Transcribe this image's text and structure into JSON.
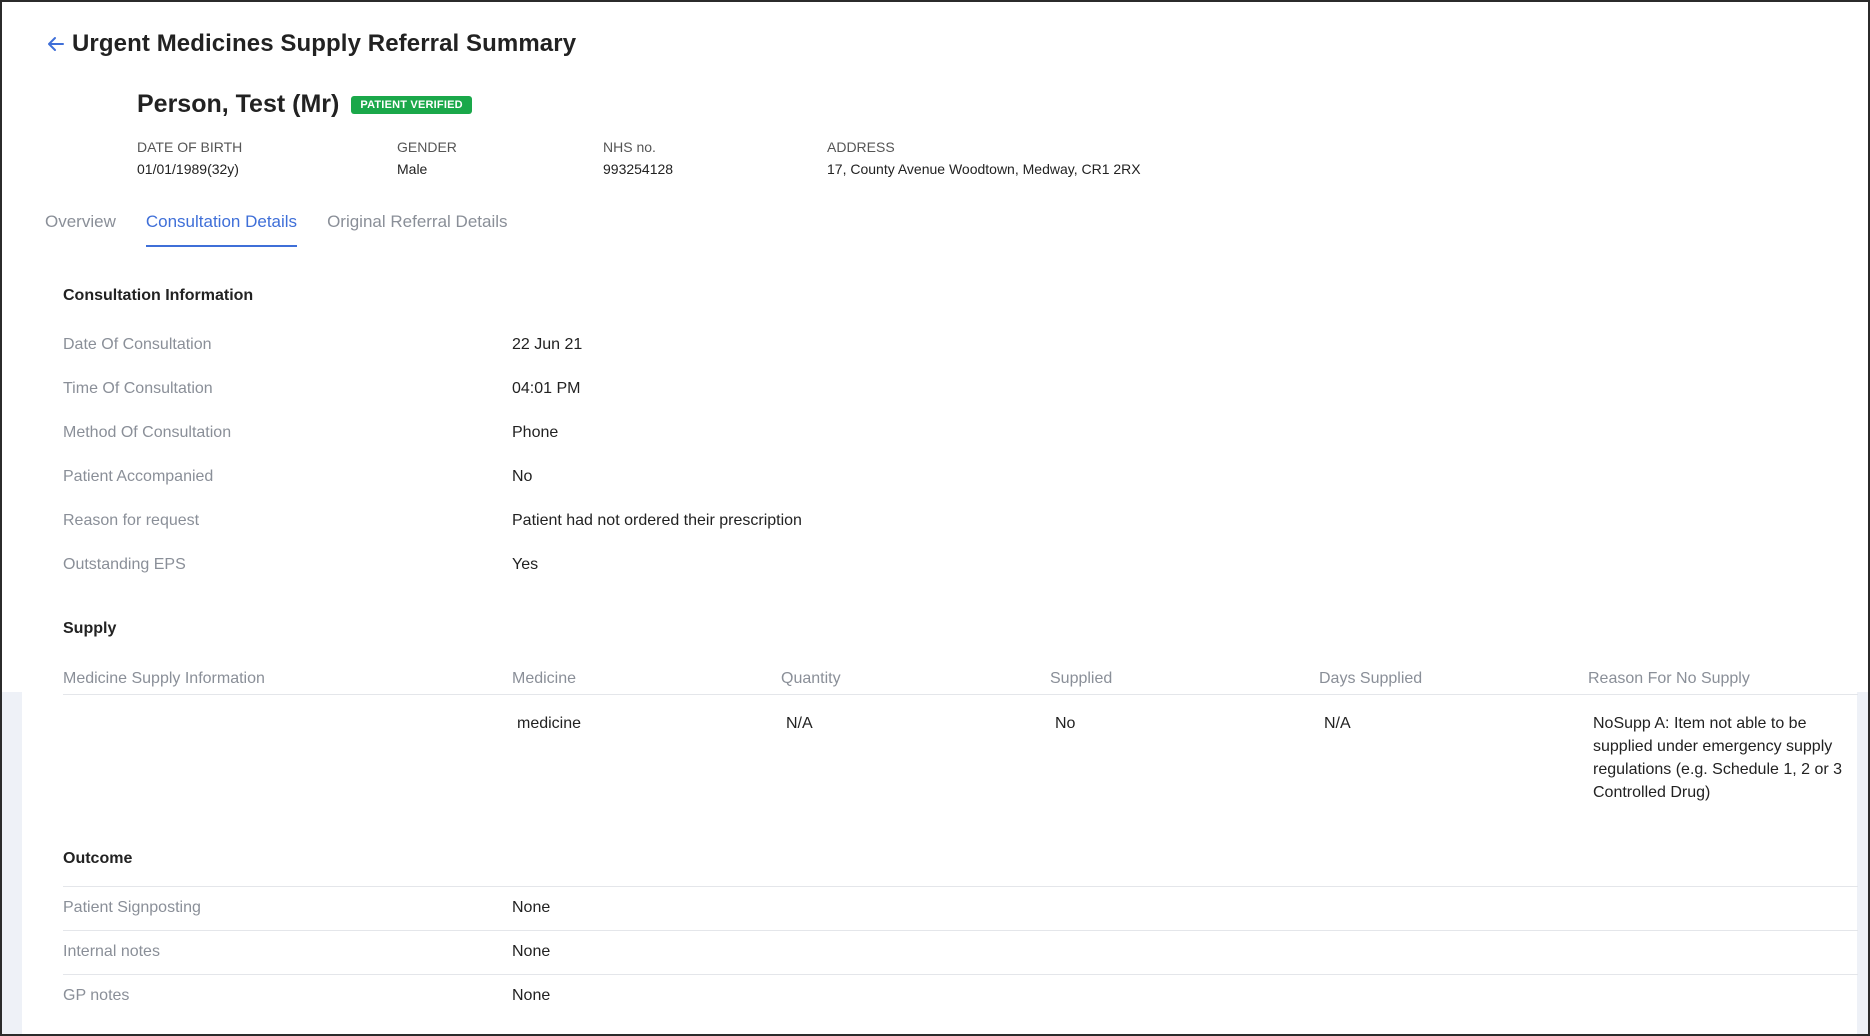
{
  "header": {
    "title": "Urgent Medicines Supply Referral Summary",
    "back_icon": "arrow-left-icon"
  },
  "patient": {
    "name": "Person, Test (Mr)",
    "badge": "PATIENT VERIFIED",
    "badge_color": "#1aa84a",
    "fields": [
      {
        "label": "DATE OF BIRTH",
        "value": "01/01/1989(32y)"
      },
      {
        "label": "GENDER",
        "value": "Male"
      },
      {
        "label": "NHS no.",
        "value": "993254128"
      },
      {
        "label": "ADDRESS",
        "value": "17, County Avenue Woodtown, Medway, CR1 2RX"
      }
    ]
  },
  "tabs": [
    {
      "label": "Overview",
      "active": false
    },
    {
      "label": "Consultation Details",
      "active": true
    },
    {
      "label": "Original Referral Details",
      "active": false
    }
  ],
  "accent_color": "#3f6fd8",
  "consultation": {
    "title": "Consultation Information",
    "rows": [
      {
        "label": "Date Of Consultation",
        "value": "22 Jun 21"
      },
      {
        "label": "Time Of Consultation",
        "value": "04:01 PM"
      },
      {
        "label": "Method Of Consultation",
        "value": "Phone"
      },
      {
        "label": "Patient Accompanied",
        "value": "No"
      },
      {
        "label": "Reason for request",
        "value": "Patient had not ordered their prescription"
      },
      {
        "label": "Outstanding EPS",
        "value": "Yes"
      }
    ]
  },
  "supply": {
    "title": "Supply",
    "columns": [
      "Medicine Supply Information",
      "Medicine",
      "Quantity",
      "Supplied",
      "Days Supplied",
      "Reason For No Supply"
    ],
    "rows": [
      {
        "info": "",
        "medicine": "medicine",
        "quantity": "N/A",
        "supplied": "No",
        "days_supplied": "N/A",
        "reason": "NoSupp A: Item not able to be supplied under emergency supply regulations (e.g. Schedule 1, 2 or 3 Controlled Drug)"
      }
    ]
  },
  "outcome": {
    "title": "Outcome",
    "rows": [
      {
        "label": "Patient Signposting",
        "value": "None"
      },
      {
        "label": "Internal notes",
        "value": "None"
      },
      {
        "label": "GP notes",
        "value": "None"
      }
    ]
  }
}
